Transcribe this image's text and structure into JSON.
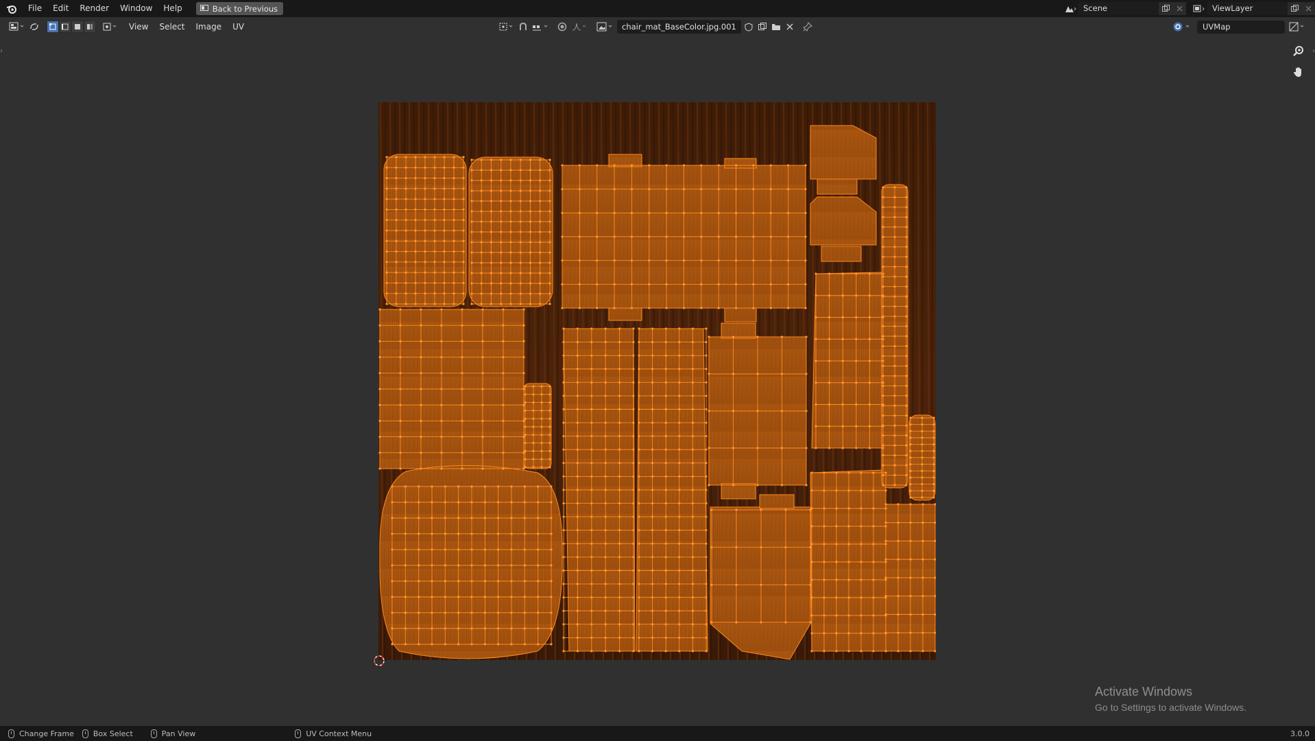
{
  "topbar": {
    "menu": [
      "File",
      "Edit",
      "Render",
      "Window",
      "Help"
    ],
    "back_button": "Back to Previous",
    "scene": "Scene",
    "view_layer": "ViewLayer"
  },
  "header": {
    "menu": [
      "View",
      "Select",
      "Image",
      "UV"
    ],
    "image_name": "chair_mat_BaseColor.jpg.001",
    "uv_map": "UVMap"
  },
  "watermark": {
    "title": "Activate Windows",
    "subtitle": "Go to Settings to activate Windows."
  },
  "statusbar": {
    "items": [
      "Change Frame",
      "Box Select",
      "Pan View",
      "UV Context Menu"
    ],
    "version": "3.0.0"
  },
  "colors": {
    "uv_edge": "#ff8a1e",
    "texture_base": "#a8540d",
    "background": "#303030",
    "active_mode": "#4772b3"
  }
}
